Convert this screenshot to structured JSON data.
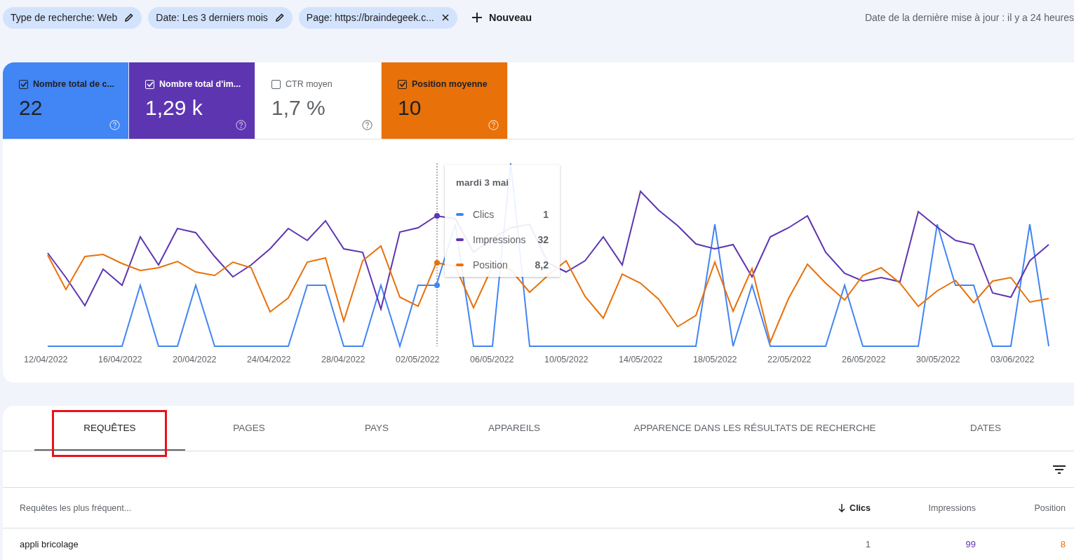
{
  "filters": [
    {
      "label": "Type de recherche: Web",
      "kind": "edit"
    },
    {
      "label": "Date: Les 3 derniers mois",
      "kind": "edit"
    },
    {
      "label": "Page: https://braindegeek.c...",
      "kind": "remove"
    }
  ],
  "new_filter": {
    "label": "Nouveau"
  },
  "last_update": "Date de la dernière mise à jour : il y a 24 heures",
  "metrics": [
    {
      "label": "Nombre total de c...",
      "value": "22",
      "checked": true,
      "color": "#4285f4"
    },
    {
      "label": "Nombre total d'im...",
      "value": "1,29 k",
      "checked": true,
      "color": "#5e35b1"
    },
    {
      "label": "CTR moyen",
      "value": "1,7 %",
      "checked": false
    },
    {
      "label": "Position moyenne",
      "value": "10",
      "checked": true,
      "color": "#e8710a"
    }
  ],
  "chart": {
    "x_labels": [
      "12/04/2022",
      "16/04/2022",
      "20/04/2022",
      "24/04/2022",
      "28/04/2022",
      "02/05/2022",
      "06/05/2022",
      "10/05/2022",
      "14/05/2022",
      "18/05/2022",
      "22/05/2022",
      "26/05/2022",
      "30/05/2022",
      "03/06/2022"
    ],
    "tooltip": {
      "title": "mardi 3 mai",
      "rows": [
        {
          "label": "Clics",
          "value": "1",
          "color": "#4285f4"
        },
        {
          "label": "Impressions",
          "value": "32",
          "color": "#5e35b1"
        },
        {
          "label": "Position",
          "value": "8,2",
          "color": "#e8710a"
        }
      ]
    }
  },
  "tabs": [
    {
      "label": "REQUÊTES",
      "selected": true,
      "highlighted": true
    },
    {
      "label": "PAGES",
      "selected": false,
      "highlighted": false
    },
    {
      "label": "PAYS",
      "selected": false,
      "highlighted": false
    },
    {
      "label": "APPAREILS",
      "selected": false,
      "highlighted": false
    },
    {
      "label": "APPARENCE DANS LES RÉSULTATS DE RECHERCHE",
      "selected": false,
      "highlighted": false
    },
    {
      "label": "DATES",
      "selected": false,
      "highlighted": false
    }
  ],
  "table": {
    "columns": [
      {
        "label": "Requêtes les plus fréquent...",
        "sorted": false
      },
      {
        "label": "Clics",
        "sorted": true
      },
      {
        "label": "Impressions",
        "sorted": false
      },
      {
        "label": "Position",
        "sorted": false
      }
    ],
    "rows": [
      [
        "appli bricolage",
        "1",
        "99",
        "8"
      ]
    ]
  }
}
